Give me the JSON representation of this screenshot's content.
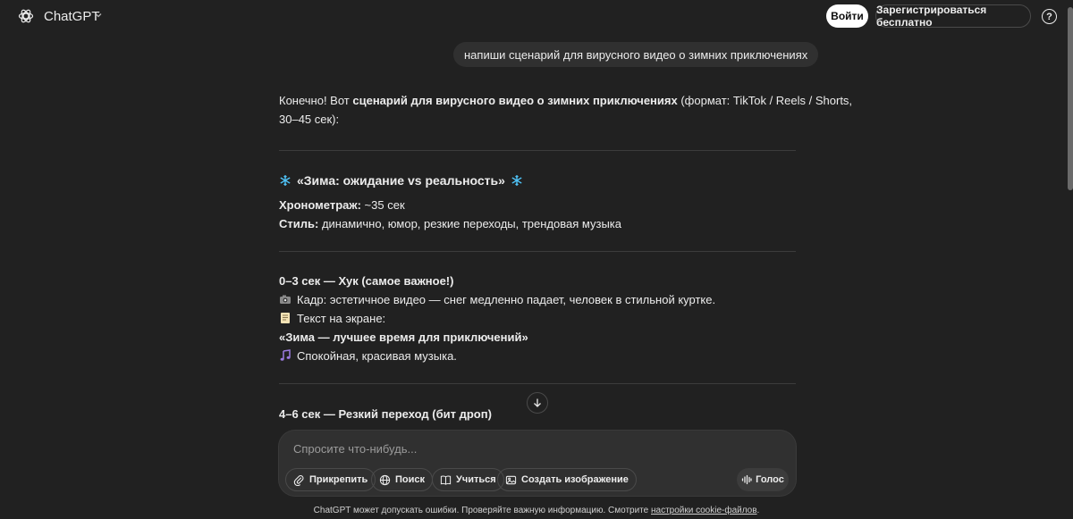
{
  "header": {
    "app_title": "ChatGPT",
    "login_label": "Войти",
    "signup_label": "Зарегистрироваться бесплатно",
    "help_label": "?"
  },
  "user_message": "напиши сценарий для вирусного видео о зимних приключениях",
  "assistant": {
    "intro_pre": "Конечно! Вот ",
    "intro_bold": "сценарий для вирусного видео о зимних приключениях",
    "intro_post": " (формат: TikTok / Reels / Shorts,",
    "intro_line2": "30–45 сек):",
    "title": "«Зима: ожидание vs реальность»",
    "duration_label": "Хронометраж:",
    "duration_value": " ~35 сек",
    "style_label": "Стиль:",
    "style_value": " динамично, юмор, резкие переходы, трендовая музыка",
    "section1_heading": "0–3 сек — Хук (самое важное!)",
    "section1_frame": "Кадр: эстетичное видео — снег медленно падает, человек в стильной куртке.",
    "section1_text_label": "Текст на экране:",
    "section1_text_value": "«Зима — лучшее время для приключений»",
    "section1_music": "Спокойная, красивая музыка.",
    "section2_heading": "4–6 сек — Резкий переход (бит дроп)"
  },
  "composer": {
    "placeholder": "Спросите что-нибудь...",
    "attach_label": "Прикрепить",
    "search_label": "Поиск",
    "study_label": "Учиться",
    "image_label": "Создать изображение",
    "voice_label": "Голос"
  },
  "footer": {
    "text": "ChatGPT может допускать ошибки. Проверяйте важную информацию. Смотрите ",
    "link": "настройки cookie-файлов",
    "end": "."
  },
  "colors": {
    "background": "#212121",
    "composer": "#303030",
    "text": "#ececec",
    "snowflake": "#4fc3f7"
  },
  "icons": [
    "chatgpt-logo-icon",
    "chevron-down-icon",
    "help-icon",
    "snowflake-icon",
    "camera-icon",
    "memo-icon",
    "music-notes-icon",
    "arrow-down-icon",
    "paperclip-icon",
    "globe-icon",
    "book-icon",
    "image-icon",
    "voice-wave-icon"
  ]
}
